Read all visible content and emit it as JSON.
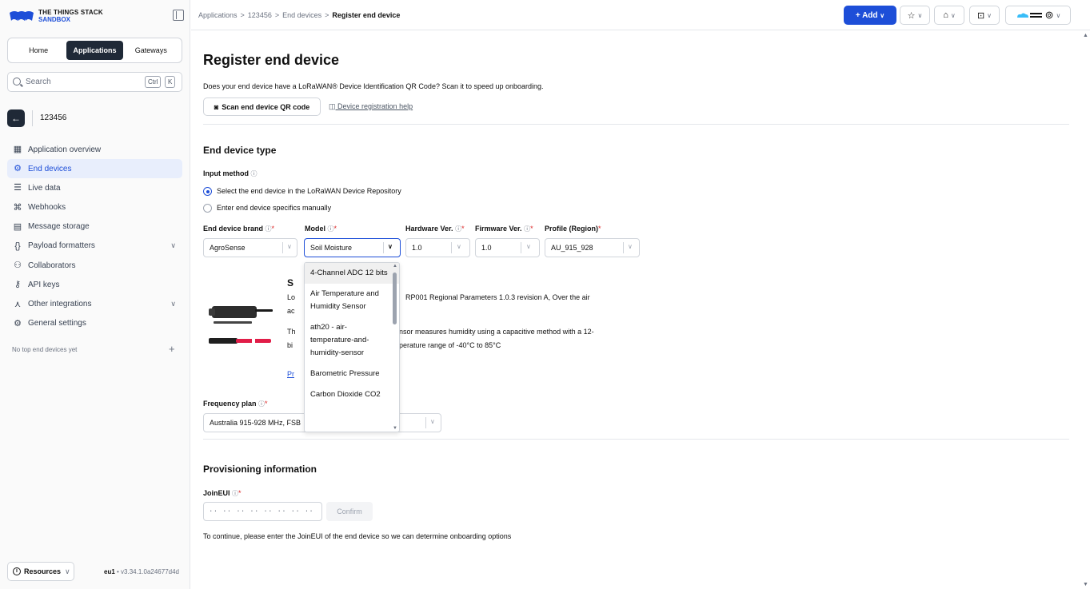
{
  "brand": {
    "line1": "THE THINGS STACK",
    "line2": "SANDBOX"
  },
  "switcher": {
    "home": "Home",
    "applications": "Applications",
    "gateways": "Gateways"
  },
  "search": {
    "placeholder": "Search",
    "key1": "Ctrl",
    "key2": "K"
  },
  "app": {
    "name": "123456"
  },
  "nav": {
    "items": [
      {
        "label": "Application overview",
        "icon": "grid-icon"
      },
      {
        "label": "End devices",
        "icon": "chip-icon",
        "active": true
      },
      {
        "label": "Live data",
        "icon": "list-icon"
      },
      {
        "label": "Webhooks",
        "icon": "webhook-icon"
      },
      {
        "label": "Message storage",
        "icon": "database-icon"
      },
      {
        "label": "Payload formatters",
        "icon": "code-icon",
        "expandable": true
      },
      {
        "label": "Collaborators",
        "icon": "users-icon"
      },
      {
        "label": "API keys",
        "icon": "key-icon"
      },
      {
        "label": "Other integrations",
        "icon": "integration-icon",
        "expandable": true
      },
      {
        "label": "General settings",
        "icon": "gear-icon"
      }
    ]
  },
  "sidebar_footer": {
    "no_top": "No top end devices yet",
    "resources": "Resources",
    "cluster": "eu1",
    "version": " • v3.34.1.0a24677d4d"
  },
  "breadcrumb": {
    "item1": "Applications",
    "item2": "123456",
    "item3": "End devices",
    "current": "Register end device"
  },
  "topbar": {
    "add": "+ Add"
  },
  "page": {
    "title": "Register end device",
    "qr_prompt": "Does your end device have a LoRaWAN® Device Identification QR Code? Scan it to speed up onboarding.",
    "scan_button": "Scan end device QR code",
    "help_link": "Device registration help"
  },
  "device_type": {
    "heading": "End device type",
    "input_method_label": "Input method",
    "option_repository": "Select the end device in the LoRaWAN Device Repository",
    "option_manual": "Enter end device specifics manually",
    "brand_label": "End device brand",
    "brand_value": "AgroSense",
    "model_label": "Model",
    "model_value": "Soil Moisture",
    "hw_label": "Hardware Ver.",
    "hw_value": "1.0",
    "fw_label": "Firmware Ver.",
    "fw_value": "1.0",
    "profile_label": "Profile (Region)",
    "profile_value": "AU_915_928"
  },
  "device_info": {
    "title_initial": "S",
    "desc_line1_start": "Lo",
    "desc_line1_end": "RP001 Regional Parameters 1.0.3 revision A, Over the air",
    "desc_line2_start": "ac",
    "desc_line3_start": "Th",
    "desc_line3_end": "Sensor measures humidity using a capacitive method with a 12-",
    "desc_line4_start": "bi",
    "desc_line4_end": "perature range of -40°C to 85°C",
    "link_initial": "Pr"
  },
  "model_dropdown": {
    "options": [
      "4-Channel ADC 12 bits",
      "Air Temperature and Humidity Sensor",
      "ath20 - air-temperature-and-humidity-sensor",
      "Barometric Pressure",
      "Carbon Dioxide CO2"
    ]
  },
  "frequency": {
    "label": "Frequency plan",
    "value": "Australia 915-928 MHz, FSB"
  },
  "provisioning": {
    "heading": "Provisioning information",
    "joineui_label": "JoinEUI",
    "joineui_placeholder": "·· ·· ·· ·· ·· ·· ·· ··",
    "confirm": "Confirm",
    "continue_text": "To continue, please enter the JoinEUI of the end device so we can determine onboarding options"
  },
  "colors": {
    "accent": "#1d4ed8",
    "dark": "#1f2937",
    "active_bg": "#e8eefc",
    "required": "#dc2626"
  }
}
